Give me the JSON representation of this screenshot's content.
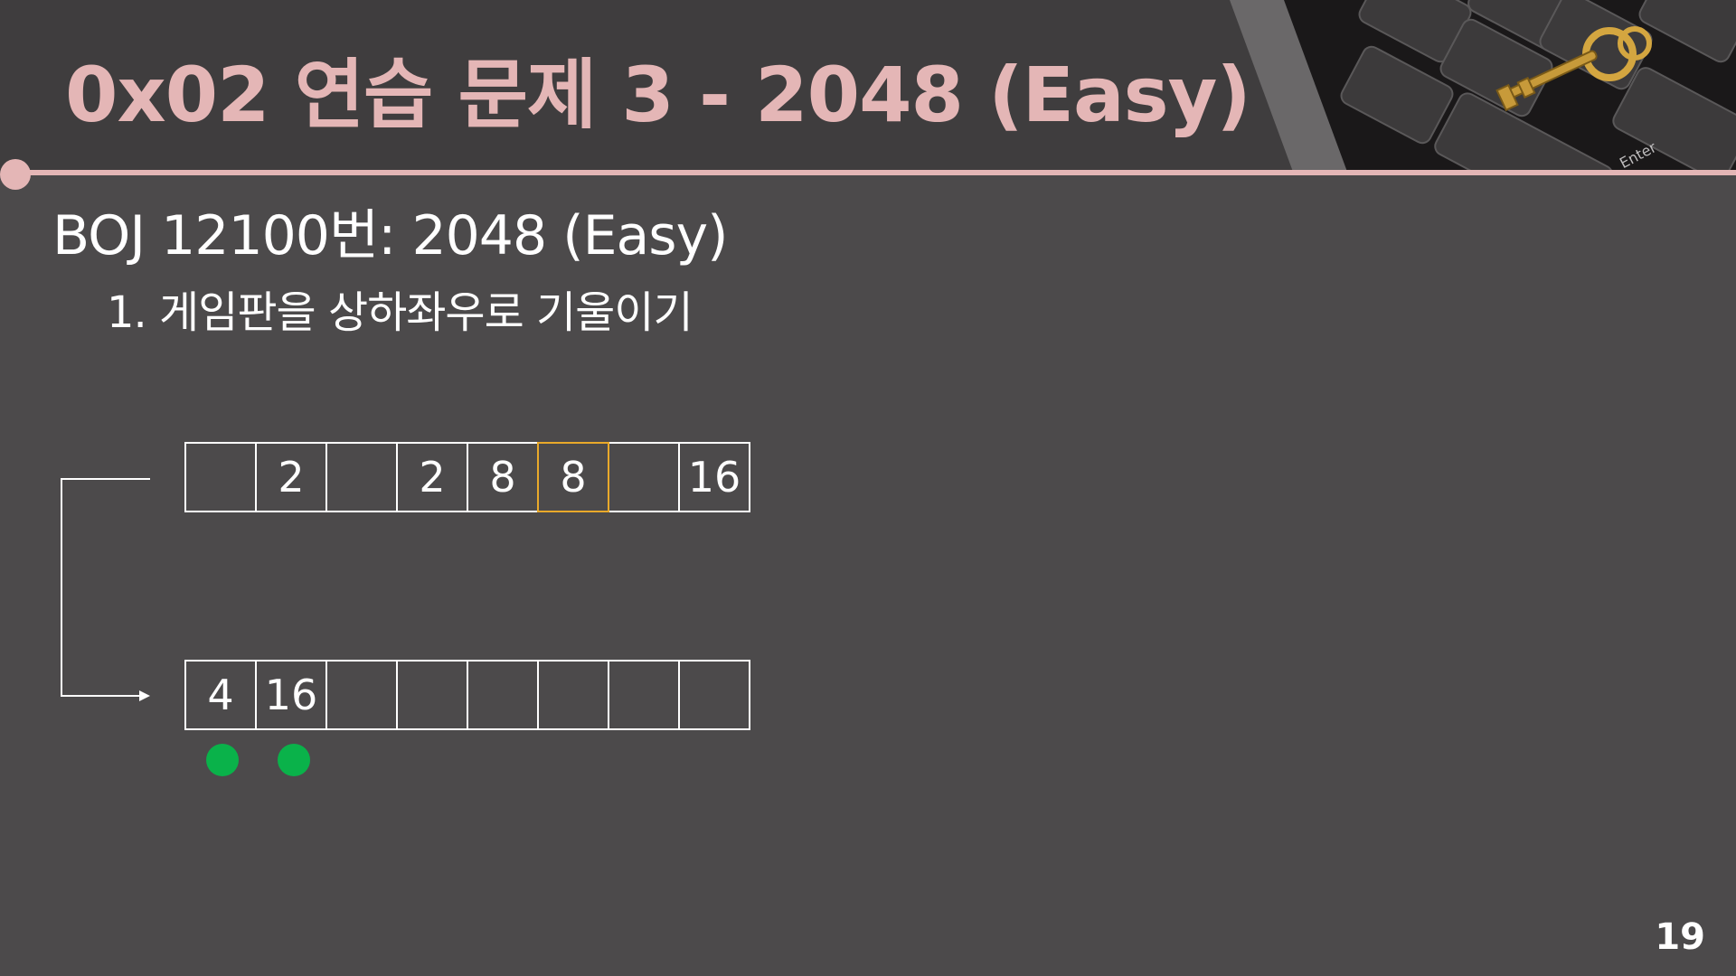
{
  "slide": {
    "title": "0x02  연습 문제 3 - 2048 (Easy)",
    "subtitle": "BOJ 12100번: 2048 (Easy)",
    "bullet": "1. 게임판을 상하좌우로 기울이기",
    "page_number": "19",
    "accent_color": "#e4b6b6",
    "background_color": "#4c4a4b"
  },
  "diagram": {
    "before_row": [
      "",
      "2",
      "",
      "2",
      "8",
      "8",
      "",
      "16"
    ],
    "before_highlight_index": 5,
    "highlight_color": "#e9a92a",
    "after_row": [
      "4",
      "16",
      "",
      "",
      "",
      "",
      "",
      ""
    ],
    "marker_color": "#0ab24a",
    "marked_after_cells": [
      0,
      1
    ]
  },
  "header_image": {
    "icon": "key-on-keyboard-enter-image",
    "key_label": "Enter"
  }
}
